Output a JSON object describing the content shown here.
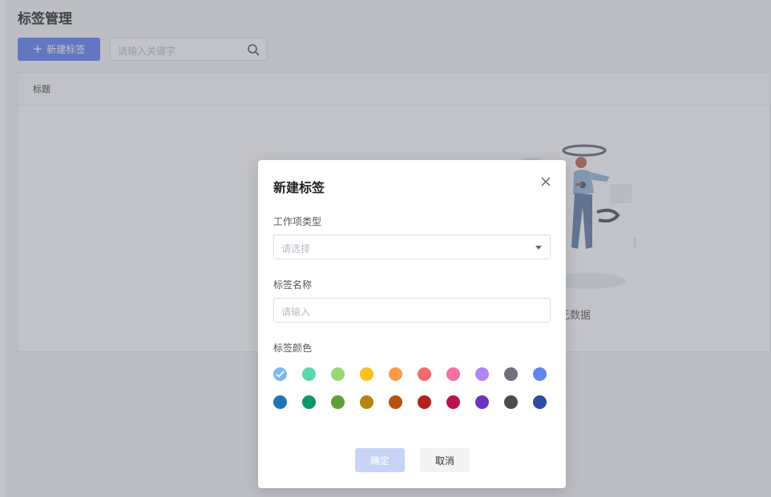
{
  "page": {
    "title": "标签管理",
    "new_button_label": "新建标签",
    "search_placeholder": "请输入关键字",
    "table_header": "标题",
    "empty_text": "暂无数据",
    "empty_text_visible": "无数据"
  },
  "dialog": {
    "title": "新建标签",
    "type_label": "工作项类型",
    "type_placeholder": "请选择",
    "name_label": "标签名称",
    "name_placeholder": "请输入",
    "color_label": "标签颜色",
    "selected_color_index": 0,
    "colors_row1": [
      "#7eb8f0",
      "#5dd6b0",
      "#98d977",
      "#f7c21b",
      "#fb9a4a",
      "#f36c6b",
      "#f46fa2",
      "#b185f4",
      "#6e7177",
      "#6387e8"
    ],
    "colors_row2": [
      "#1f74b8",
      "#11956a",
      "#5f9f36",
      "#b68413",
      "#b8530b",
      "#b5211f",
      "#b8134f",
      "#6b33c2",
      "#4a4c51",
      "#2f4aa3"
    ],
    "ok_label": "确定",
    "cancel_label": "取消"
  }
}
